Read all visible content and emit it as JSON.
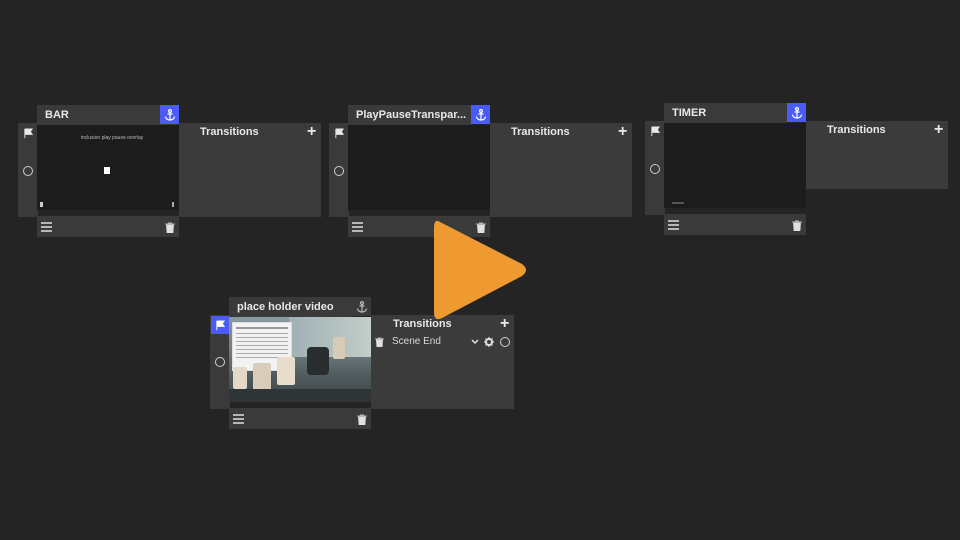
{
  "scenes": [
    {
      "title": "BAR",
      "preview_text": "inclusion play pause overlay",
      "transitions_label": "Transitions"
    },
    {
      "title": "PlayPauseTranspar...",
      "transitions_label": "Transitions"
    },
    {
      "title": "TIMER",
      "transitions_label": "Transitions"
    },
    {
      "title": "place holder video",
      "transitions_label": "Transitions",
      "transition_item": "Scene End"
    }
  ],
  "colors": {
    "background": "#242424",
    "panel": "#3a3a3a",
    "accent_blue": "#4a5cf5",
    "play_orange": "#ef9a30"
  },
  "icons": [
    "flag-icon",
    "anchor-icon",
    "menu-icon",
    "trash-icon",
    "plus-icon",
    "gear-icon",
    "chevron-down-icon",
    "play-icon"
  ]
}
